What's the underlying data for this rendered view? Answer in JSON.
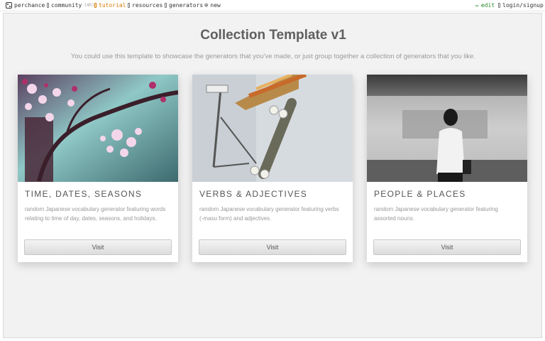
{
  "nav": {
    "perchance": "perchance",
    "community": "community",
    "community_badge": "(4h)",
    "tutorial": "tutorial",
    "resources": "resources",
    "generators": "generators",
    "new": "new",
    "edit": "edit",
    "login": "login/signup"
  },
  "page": {
    "title": "Collection Template v1",
    "subtitle": "You could use this template to showcase the generators that you've made, or just group together a collection of generators that you like."
  },
  "cards": [
    {
      "title": "TIME, DATES, SEASONS",
      "description": "random Japanese vocabulary generator featuring words relating to time of day, dates, seasons, and holidays.",
      "button": "Visit"
    },
    {
      "title": "VERBS & ADJECTIVES",
      "description": "random Japanese vocabulary generator featuring verbs (-masu form) and adjectives.",
      "button": "Visit"
    },
    {
      "title": "PEOPLE & PLACES",
      "description": "random Japanese vocabulary generator featuring assorted nouns.",
      "button": "Visit"
    }
  ],
  "colors": {
    "tutorial_accent": "#d97a00",
    "edit_accent": "#2a8a2a",
    "panel_bg": "#f2f2f2"
  }
}
